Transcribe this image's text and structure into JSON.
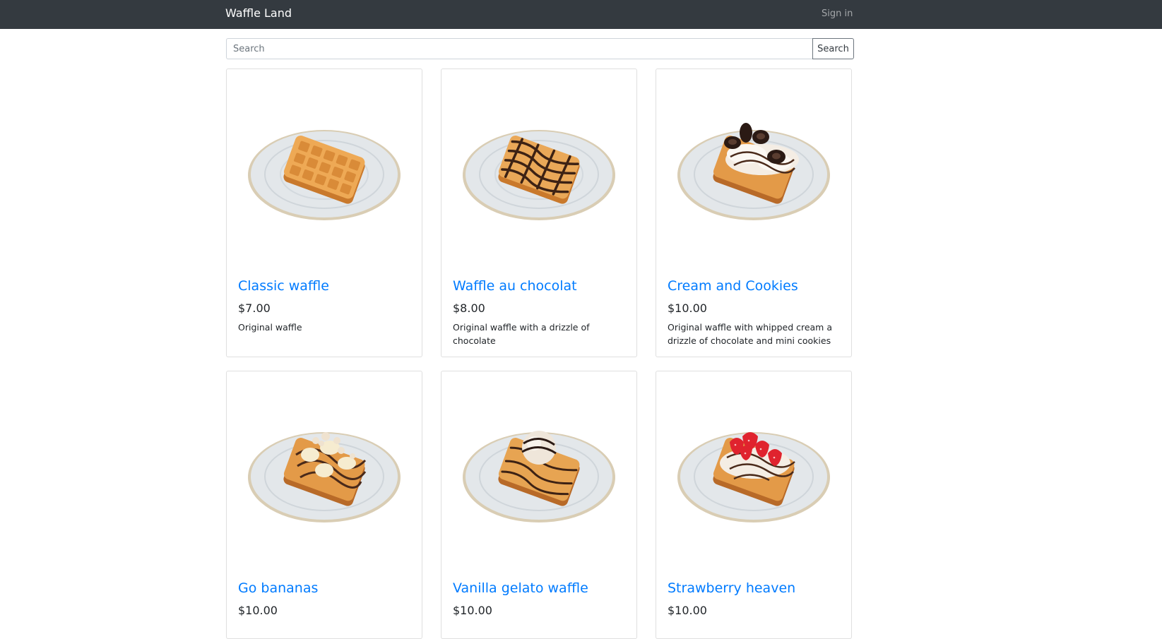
{
  "navbar": {
    "brand": "Waffle Land",
    "sign_in": "Sign in"
  },
  "search": {
    "placeholder": "Search",
    "value": "",
    "button_label": "Search"
  },
  "products": [
    {
      "name": "Classic waffle",
      "price": "$7.00",
      "description": "Original waffle",
      "topping": "plain"
    },
    {
      "name": "Waffle au chocolat",
      "price": "$8.00",
      "description": "Original waffle with a drizzle of chocolate",
      "topping": "chocolate"
    },
    {
      "name": "Cream and Cookies",
      "price": "$10.00",
      "description": "Original waffle with whipped cream a drizzle of chocolate and mini cookies",
      "topping": "cookies"
    },
    {
      "name": "Go bananas",
      "price": "$10.00",
      "description": "",
      "topping": "banana"
    },
    {
      "name": "Vanilla gelato waffle",
      "price": "$10.00",
      "description": "",
      "topping": "gelato"
    },
    {
      "name": "Strawberry heaven",
      "price": "$10.00",
      "description": "",
      "topping": "strawberry"
    }
  ],
  "colors": {
    "navbar_bg": "#343a40",
    "link": "#007bff",
    "waffle": "#e9a452",
    "chocolate": "#4a2a1a",
    "plate": "#dfe3e6",
    "strawberry": "#e0232e"
  }
}
